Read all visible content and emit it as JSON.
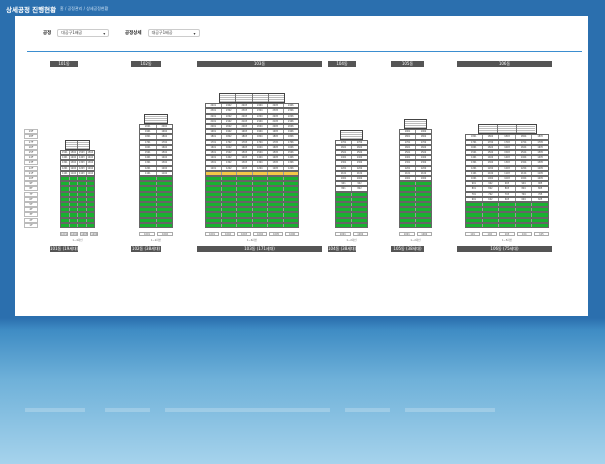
{
  "header": {
    "title": "상세공정 진행현황",
    "breadcrumb": [
      "홈",
      "공정관리",
      "상세공정현황"
    ]
  },
  "filters": [
    {
      "label": "공정",
      "value": "대공구1배공",
      "icon": "chevron-down-icon"
    },
    {
      "label": "공정상세",
      "value": "대공구1배공",
      "icon": "chevron-down-icon"
    }
  ],
  "colors": {
    "done": "#19b030",
    "progress": "#f3c847",
    "pending": "#ffffff",
    "roof": "#f2f2f2",
    "header": "#555555",
    "accent": "#3b8ed0"
  },
  "floor_labels": [
    "19F",
    "18F",
    "17F",
    "16F",
    "15F",
    "14F",
    "13F",
    "12F",
    "11F",
    "10F",
    "9F",
    "8F",
    "7F",
    "6F",
    "5F",
    "4F",
    "3F",
    "2F",
    "1F"
  ],
  "buildings": [
    {
      "header": "101동",
      "footer": "101동 (19세대)",
      "cols": 4,
      "done": 10,
      "progress": 0,
      "pending": 5,
      "units": [
        "1001",
        "1002",
        "1003",
        "1004"
      ],
      "group_label": "1~4라인"
    },
    {
      "header": "102동",
      "footer": "102동 (38세대)",
      "cols": 2,
      "done": 10,
      "progress": 0,
      "pending": 10,
      "units": [
        "1001",
        "1002"
      ],
      "group_label": "1~2라인"
    },
    {
      "header": "103동",
      "footer": "103동 (171세대)",
      "cols": 6,
      "done": 10,
      "progress": 1,
      "pending": 13,
      "units": [
        "1001",
        "1002",
        "1003",
        "1004",
        "1005",
        "1006"
      ],
      "group_label": "1~6라인"
    },
    {
      "header": "104동",
      "footer": "104동 (38세대)",
      "cols": 2,
      "done": 7,
      "progress": 0,
      "pending": 10,
      "units": [
        "1001",
        "1002"
      ],
      "group_label": "1~2라인"
    },
    {
      "header": "105동",
      "footer": "105동 (38세대)",
      "cols": 2,
      "done": 9,
      "progress": 0,
      "pending": 10,
      "units": [
        "1001",
        "1002"
      ],
      "group_label": "1~2라인"
    },
    {
      "header": "106동",
      "footer": "106동 (75세대)",
      "cols": 5,
      "done": 5,
      "progress": 0,
      "pending": 13,
      "units": [
        "101",
        "102",
        "103",
        "104",
        "105"
      ],
      "group_label": "1~5라인"
    }
  ]
}
